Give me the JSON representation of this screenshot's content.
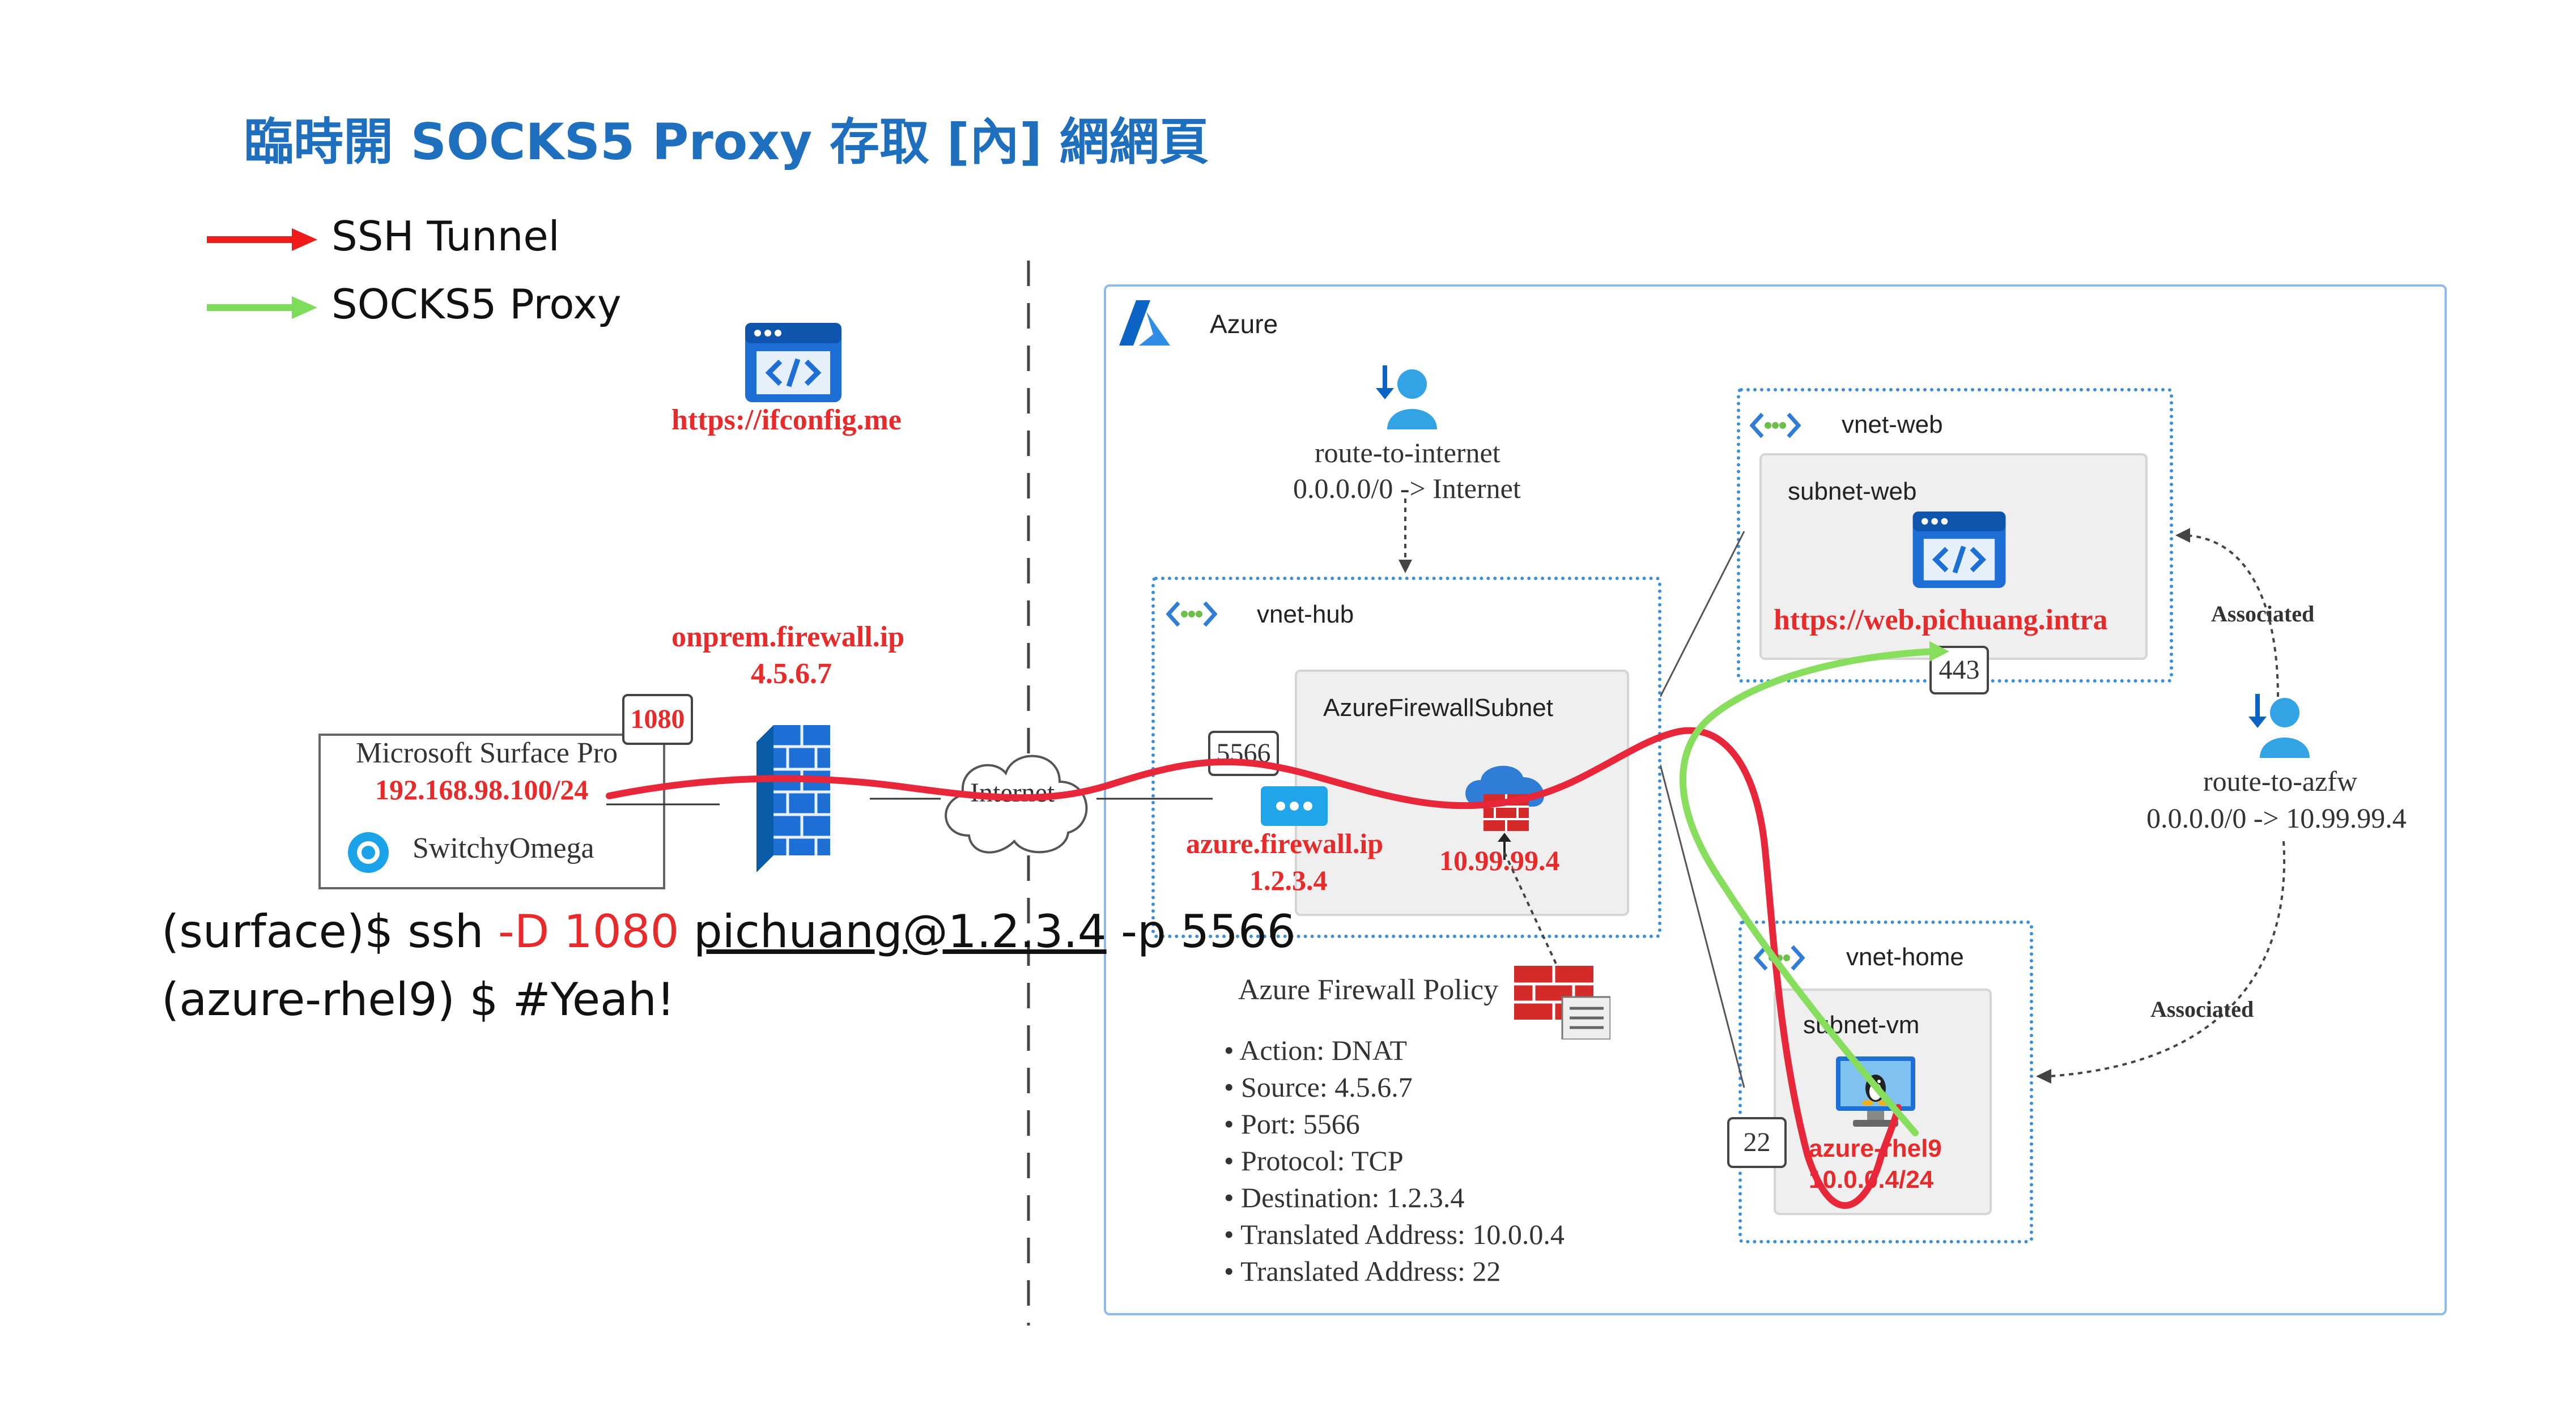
{
  "title": "臨時開 SOCKS5 Proxy 存取 [內] 網網頁",
  "legend": [
    {
      "label": "SSH Tunnel",
      "color": "#f01c1c"
    },
    {
      "label": "SOCKS5 Proxy",
      "color": "#7ddc5a"
    }
  ],
  "ifconfig": {
    "url": "https://ifconfig.me",
    "icon": "web-app-icon"
  },
  "onprem_firewall": {
    "name": "onprem.firewall.ip",
    "ip": "4.5.6.7",
    "icon": "firewall-icon"
  },
  "surface": {
    "name": "Microsoft Surface Pro",
    "ip": "192.168.98.100/24",
    "app": "SwitchyOmega",
    "port": "1080"
  },
  "internet": "Internet",
  "azure": {
    "label": "Azure",
    "icon": "azure-logo-icon"
  },
  "route_internet": {
    "name": "route-to-internet",
    "rule": "0.0.0.0/0 -> Internet",
    "icon": "route-table-icon"
  },
  "vnet_hub": {
    "label": "vnet-hub",
    "icon": "vnet-icon"
  },
  "firewall_subnet": {
    "label": "AzureFirewallSubnet",
    "port": "5566",
    "public_ip_name": "azure.firewall.ip",
    "public_ip": "1.2.3.4",
    "private_ip": "10.99.99.4"
  },
  "policy": {
    "title": "Azure Firewall Policy",
    "items": [
      "Action: DNAT",
      "Source:  4.5.6.7",
      "Port: 5566",
      "Protocol: TCP",
      "Destination: 1.2.3.4",
      "Translated Address: 10.0.0.4",
      "Translated Address: 22"
    ]
  },
  "vnet_web": {
    "label": "vnet-web",
    "subnet": "subnet-web",
    "url": "https://web.pichuang.intra",
    "port": "443"
  },
  "route_azfw": {
    "name": "route-to-azfw",
    "rule": "0.0.0.0/0 -> 10.99.99.4",
    "icon": "route-table-icon"
  },
  "associated_1": "Associated",
  "associated_2": "Associated",
  "vnet_home": {
    "label": "vnet-home",
    "subnet": "subnet-vm",
    "vm_name": "azure-rhel9",
    "vm_ip": "10.0.0.4/24",
    "port": "22"
  },
  "command": {
    "prompt1": "(surface)$ ssh ",
    "flag": "-D 1080",
    "sp": " ",
    "target": "pichuang@1.2.3.4",
    "rest": " -p 5566",
    "line2": "(azure-rhel9) $ #Yeah!"
  }
}
